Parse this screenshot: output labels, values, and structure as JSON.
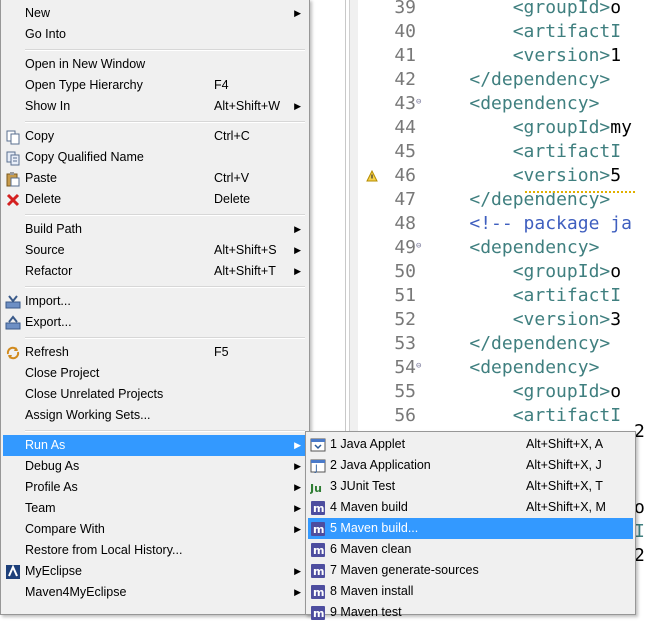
{
  "editor": {
    "lines": [
      {
        "n": "39",
        "fold": "",
        "parts": [
          [
            "ind",
            "        "
          ],
          [
            "tag",
            "<"
          ],
          [
            "tagname",
            "groupId"
          ],
          [
            "tag",
            ">"
          ],
          [
            "text",
            "o"
          ]
        ]
      },
      {
        "n": "40",
        "fold": "",
        "parts": [
          [
            "ind",
            "        "
          ],
          [
            "tag",
            "<"
          ],
          [
            "tagname",
            "artifactI"
          ]
        ]
      },
      {
        "n": "41",
        "fold": "",
        "parts": [
          [
            "ind",
            "        "
          ],
          [
            "tag",
            "<"
          ],
          [
            "tagname",
            "version"
          ],
          [
            "tag",
            ">"
          ],
          [
            "text",
            "1"
          ]
        ]
      },
      {
        "n": "42",
        "fold": "",
        "parts": [
          [
            "ind",
            "    "
          ],
          [
            "tag",
            "</"
          ],
          [
            "tagname",
            "dependency"
          ],
          [
            "tag",
            ">"
          ]
        ]
      },
      {
        "n": "43",
        "fold": "⊖",
        "parts": [
          [
            "ind",
            "    "
          ],
          [
            "tag",
            "<"
          ],
          [
            "tagname",
            "dependency"
          ],
          [
            "tag",
            ">"
          ]
        ]
      },
      {
        "n": "44",
        "fold": "",
        "parts": [
          [
            "ind",
            "        "
          ],
          [
            "tag",
            "<"
          ],
          [
            "tagname",
            "groupId"
          ],
          [
            "tag",
            ">"
          ],
          [
            "text",
            "my"
          ]
        ]
      },
      {
        "n": "45",
        "fold": "",
        "parts": [
          [
            "ind",
            "        "
          ],
          [
            "tag",
            "<"
          ],
          [
            "tagname",
            "artifactI"
          ]
        ]
      },
      {
        "n": "46",
        "fold": "",
        "parts": [
          [
            "ind",
            "        "
          ],
          [
            "tag",
            "<"
          ],
          [
            "tagname",
            "version"
          ],
          [
            "tag",
            ">"
          ],
          [
            "text",
            "5"
          ]
        ]
      },
      {
        "n": "47",
        "fold": "",
        "parts": [
          [
            "ind",
            "    "
          ],
          [
            "tag",
            "</"
          ],
          [
            "tagname",
            "dependency"
          ],
          [
            "tag",
            ">"
          ]
        ]
      },
      {
        "n": "48",
        "fold": "",
        "parts": [
          [
            "ind",
            "    "
          ],
          [
            "cmt",
            "<!-- package ja"
          ]
        ]
      },
      {
        "n": "49",
        "fold": "⊖",
        "parts": [
          [
            "ind",
            "    "
          ],
          [
            "tag",
            "<"
          ],
          [
            "tagname",
            "dependency"
          ],
          [
            "tag",
            ">"
          ]
        ]
      },
      {
        "n": "50",
        "fold": "",
        "parts": [
          [
            "ind",
            "        "
          ],
          [
            "tag",
            "<"
          ],
          [
            "tagname",
            "groupId"
          ],
          [
            "tag",
            ">"
          ],
          [
            "text",
            "o"
          ]
        ]
      },
      {
        "n": "51",
        "fold": "",
        "parts": [
          [
            "ind",
            "        "
          ],
          [
            "tag",
            "<"
          ],
          [
            "tagname",
            "artifactI"
          ]
        ]
      },
      {
        "n": "52",
        "fold": "",
        "parts": [
          [
            "ind",
            "        "
          ],
          [
            "tag",
            "<"
          ],
          [
            "tagname",
            "version"
          ],
          [
            "tag",
            ">"
          ],
          [
            "text",
            "3"
          ]
        ]
      },
      {
        "n": "53",
        "fold": "",
        "parts": [
          [
            "ind",
            "    "
          ],
          [
            "tag",
            "</"
          ],
          [
            "tagname",
            "dependency"
          ],
          [
            "tag",
            ">"
          ]
        ]
      },
      {
        "n": "54",
        "fold": "⊖",
        "parts": [
          [
            "ind",
            "    "
          ],
          [
            "tag",
            "<"
          ],
          [
            "tagname",
            "dependency"
          ],
          [
            "tag",
            ">"
          ]
        ]
      },
      {
        "n": "55",
        "fold": "",
        "parts": [
          [
            "ind",
            "        "
          ],
          [
            "tag",
            "<"
          ],
          [
            "tagname",
            "groupId"
          ],
          [
            "tag",
            ">"
          ],
          [
            "text",
            "o"
          ]
        ]
      },
      {
        "n": "56",
        "fold": "",
        "parts": [
          [
            "ind",
            "        "
          ],
          [
            "tag",
            "<"
          ],
          [
            "tagname",
            "artifactI"
          ]
        ]
      }
    ],
    "peek_lines": [
      "2",
      "o",
      "I",
      "2"
    ]
  },
  "menu": {
    "items": [
      {
        "label": "New",
        "accel": "",
        "submenu": true,
        "icon": ""
      },
      {
        "label": "Go Into",
        "accel": "",
        "submenu": false,
        "icon": ""
      },
      {
        "sep": true
      },
      {
        "label": "Open in New Window",
        "accel": "",
        "submenu": false,
        "icon": ""
      },
      {
        "label": "Open Type Hierarchy",
        "accel": "F4",
        "submenu": false,
        "icon": ""
      },
      {
        "label": "Show In",
        "accel": "Alt+Shift+W",
        "submenu": true,
        "icon": ""
      },
      {
        "sep": true
      },
      {
        "label": "Copy",
        "accel": "Ctrl+C",
        "submenu": false,
        "icon": "copy-icon"
      },
      {
        "label": "Copy Qualified Name",
        "accel": "",
        "submenu": false,
        "icon": "copy-qualified-icon"
      },
      {
        "label": "Paste",
        "accel": "Ctrl+V",
        "submenu": false,
        "icon": "paste-icon"
      },
      {
        "label": "Delete",
        "accel": "Delete",
        "submenu": false,
        "icon": "delete-icon"
      },
      {
        "sep": true
      },
      {
        "label": "Build Path",
        "accel": "",
        "submenu": true,
        "icon": ""
      },
      {
        "label": "Source",
        "accel": "Alt+Shift+S",
        "submenu": true,
        "icon": ""
      },
      {
        "label": "Refactor",
        "accel": "Alt+Shift+T",
        "submenu": true,
        "icon": ""
      },
      {
        "sep": true
      },
      {
        "label": "Import...",
        "accel": "",
        "submenu": false,
        "icon": "import-icon"
      },
      {
        "label": "Export...",
        "accel": "",
        "submenu": false,
        "icon": "export-icon"
      },
      {
        "sep": true
      },
      {
        "label": "Refresh",
        "accel": "F5",
        "submenu": false,
        "icon": "refresh-icon"
      },
      {
        "label": "Close Project",
        "accel": "",
        "submenu": false,
        "icon": ""
      },
      {
        "label": "Close Unrelated Projects",
        "accel": "",
        "submenu": false,
        "icon": ""
      },
      {
        "label": "Assign Working Sets...",
        "accel": "",
        "submenu": false,
        "icon": ""
      },
      {
        "sep": true
      },
      {
        "label": "Run As",
        "accel": "",
        "submenu": true,
        "icon": "",
        "highlighted": true
      },
      {
        "label": "Debug As",
        "accel": "",
        "submenu": true,
        "icon": ""
      },
      {
        "label": "Profile As",
        "accel": "",
        "submenu": true,
        "icon": ""
      },
      {
        "label": "Team",
        "accel": "",
        "submenu": true,
        "icon": ""
      },
      {
        "label": "Compare With",
        "accel": "",
        "submenu": true,
        "icon": ""
      },
      {
        "label": "Restore from Local History...",
        "accel": "",
        "submenu": false,
        "icon": ""
      },
      {
        "label": "MyEclipse",
        "accel": "",
        "submenu": true,
        "icon": "myeclipse-icon"
      },
      {
        "label": "Maven4MyEclipse",
        "accel": "",
        "submenu": true,
        "icon": ""
      }
    ]
  },
  "submenu": {
    "items": [
      {
        "label": "1 Java Applet",
        "accel": "Alt+Shift+X, A",
        "icon": "java-applet-icon"
      },
      {
        "label": "2 Java Application",
        "accel": "Alt+Shift+X, J",
        "icon": "java-application-icon"
      },
      {
        "label": "3 JUnit Test",
        "accel": "Alt+Shift+X, T",
        "icon": "junit-icon",
        "icon_text": "Ju"
      },
      {
        "label": "4 Maven build",
        "accel": "Alt+Shift+X, M",
        "icon": "maven-icon",
        "icon_text": "m"
      },
      {
        "label": "5 Maven build...",
        "accel": "",
        "icon": "maven-icon",
        "icon_text": "m",
        "highlighted": true
      },
      {
        "label": "6 Maven clean",
        "accel": "",
        "icon": "maven-icon",
        "icon_text": "m"
      },
      {
        "label": "7 Maven generate-sources",
        "accel": "",
        "icon": "maven-icon",
        "icon_text": "m"
      },
      {
        "label": "8 Maven install",
        "accel": "",
        "icon": "maven-icon",
        "icon_text": "m"
      },
      {
        "label": "9 Maven test",
        "accel": "",
        "icon": "maven-icon",
        "icon_text": "m"
      }
    ]
  },
  "colors": {
    "menu_bg": "#f0f0f0",
    "highlight": "#3399ff",
    "xml_tag": "#3f7f7f",
    "xml_comment": "#3f5fbf",
    "line_number": "#787878"
  }
}
